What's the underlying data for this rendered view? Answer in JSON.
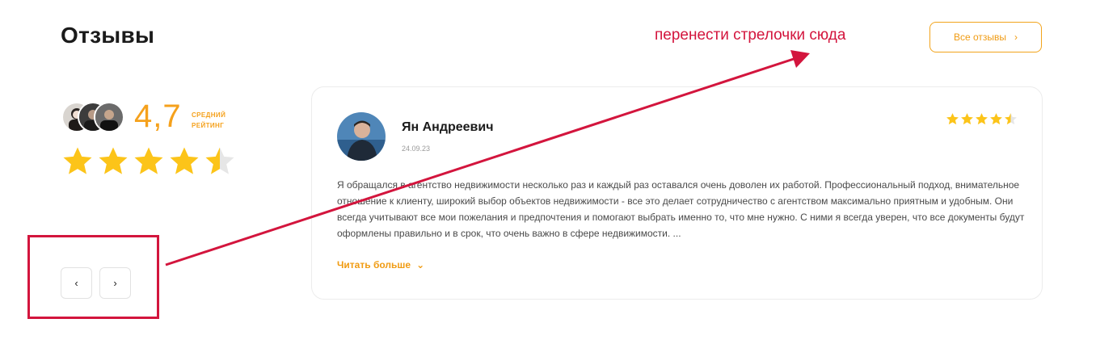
{
  "header": {
    "title": "Отзывы",
    "all_reviews_label": "Все отзывы",
    "all_reviews_icon": "chevron-right-icon"
  },
  "annotation": {
    "text": "перенести стрелочки сюда",
    "color": "#d3153d"
  },
  "summary": {
    "rating_value": "4,7",
    "caption_line1": "средний",
    "caption_line2": "рейтинг",
    "stars_value": 4.5,
    "stars_max": 5
  },
  "navigation": {
    "prev_label": "‹",
    "next_label": "›"
  },
  "review": {
    "author": "Ян Андреевич",
    "date": "24.09.23",
    "rating": 4.5,
    "text": "Я обращался в агентство недвижимости несколько раз и каждый раз оставался очень доволен их работой. Профессиональный подход, внимательное отношение к клиенту, широкий выбор объектов недвижимости - все это делает сотрудничество с агентством максимально приятным и удобным. Они всегда учитывают все мои пожелания и предпочтения и помогают выбрать именно то, что мне нужно. С ними я всегда уверен, что все документы будут оформлены правильно и в срок, что очень важно в сфере недвижимости. ...",
    "read_more": "Читать больше",
    "read_more_icon": "chevron-down-icon"
  },
  "colors": {
    "accent": "#f5a11c",
    "star": "#fcc419",
    "star_empty": "#e6e6e6",
    "annotation": "#d3153d"
  }
}
